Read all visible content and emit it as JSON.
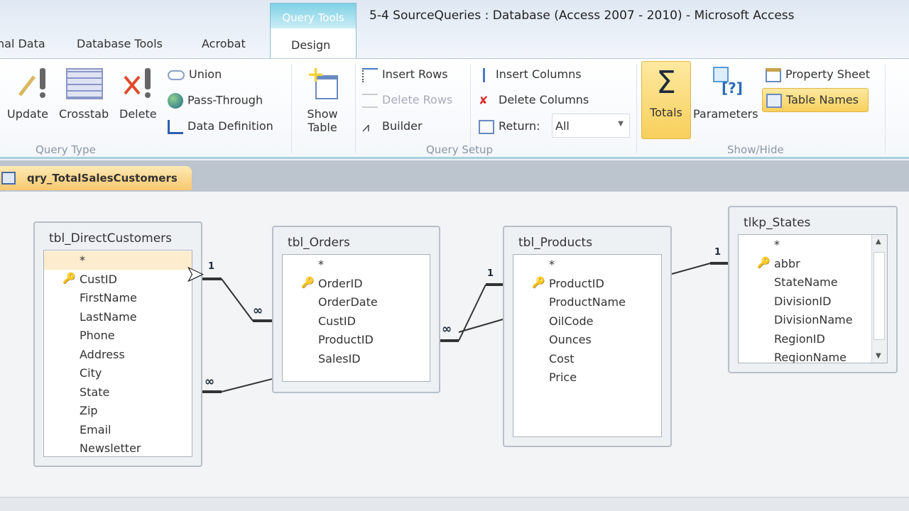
{
  "window": {
    "title": "5-4 SourceQueries : Database (Access 2007 - 2010)  -  Microsoft Access",
    "context_tab_group": "Query Tools"
  },
  "tabs": [
    {
      "label": "nal Data"
    },
    {
      "label": "Database Tools"
    },
    {
      "label": "Acrobat"
    },
    {
      "label": "Design",
      "active": true
    }
  ],
  "ribbon": {
    "query_type": {
      "label": "Query Type",
      "buttons": [
        "Update",
        "Crosstab",
        "Delete"
      ],
      "small": [
        "Union",
        "Pass-Through",
        "Data Definition"
      ]
    },
    "show_table": {
      "line1": "Show",
      "line2": "Table"
    },
    "query_setup": {
      "label": "Query Setup",
      "insert_rows": "Insert Rows",
      "delete_rows": "Delete Rows",
      "builder": "Builder",
      "insert_columns": "Insert Columns",
      "delete_columns": "Delete Columns",
      "return_label": "Return:",
      "return_value": "All"
    },
    "show_hide": {
      "label": "Show/Hide",
      "totals": "Totals",
      "parameters": "Parameters",
      "property_sheet": "Property Sheet",
      "table_names": "Table Names",
      "totals_symbol": "Σ"
    }
  },
  "document_tab": "qry_TotalSalesCustomers",
  "tables": [
    {
      "name": "tbl_DirectCustomers",
      "fields": [
        "*",
        "CustID",
        "FirstName",
        "LastName",
        "Phone",
        "Address",
        "City",
        "State",
        "Zip",
        "Email",
        "Newsletter"
      ],
      "key": "CustID"
    },
    {
      "name": "tbl_Orders",
      "fields": [
        "*",
        "OrderID",
        "OrderDate",
        "CustID",
        "ProductID",
        "SalesID"
      ],
      "key": "OrderID"
    },
    {
      "name": "tbl_Products",
      "fields": [
        "*",
        "ProductID",
        "ProductName",
        "OilCode",
        "Ounces",
        "Cost",
        "Price"
      ],
      "key": "ProductID"
    },
    {
      "name": "tlkp_States",
      "fields": [
        "*",
        "abbr",
        "StateName",
        "DivisionID",
        "DivisionName",
        "RegionID",
        "RegionName"
      ],
      "key": "abbr"
    }
  ],
  "relationships": {
    "one": "1",
    "many": "∞"
  },
  "colors": {
    "accent": "#f8c86e",
    "context": "#7fd0e6",
    "highlight": "#fbd86a"
  }
}
